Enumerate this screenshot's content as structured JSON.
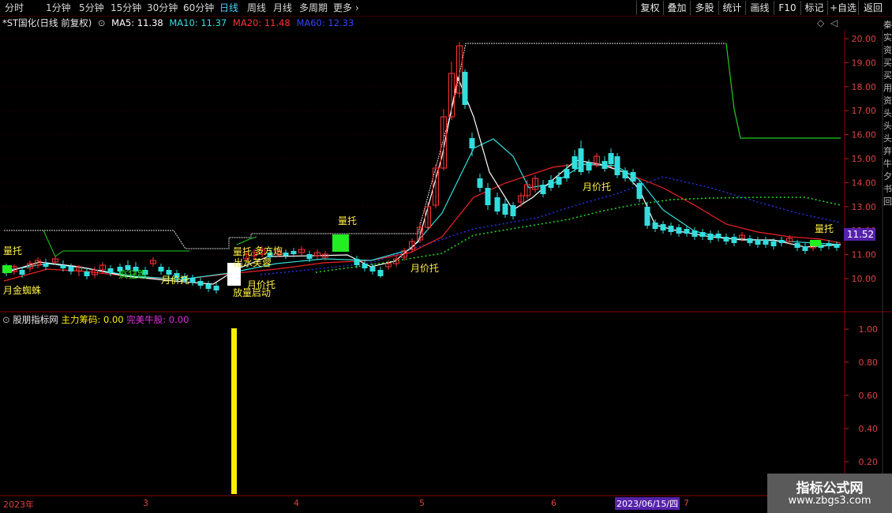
{
  "toolbar": {
    "tabs": [
      "分时",
      "1分钟",
      "5分钟",
      "15分钟",
      "30分钟",
      "60分钟",
      "日线",
      "周线",
      "月线",
      "多周期",
      "更多"
    ],
    "active_tab": "日线",
    "right_buttons": [
      "复权",
      "叠加",
      "多股",
      "统计",
      "画线",
      "F10",
      "标记",
      "+自选",
      "返回"
    ]
  },
  "info": {
    "stock": "*ST国化(日线 前复权)",
    "ma5": "MA5: 11.38",
    "ma10": "MA10: 11.37",
    "ma20": "MA20: 11.48",
    "ma60": "MA60: 12.33",
    "colors": {
      "ma5": "#ffffff",
      "ma10": "#33dddd",
      "ma20": "#ff3333",
      "ma60": "#3344ff"
    }
  },
  "price_axis": [
    "20.00",
    "19.00",
    "18.00",
    "17.00",
    "16.00",
    "15.00",
    "14.00",
    "13.00",
    "12.00",
    "11.00",
    "10.00"
  ],
  "current_price": "11.52",
  "right_side_text": [
    "秦",
    "实",
    "资",
    "买",
    "买",
    "用",
    "资",
    "头",
    "头",
    "头",
    "弃",
    "牛",
    "夕",
    "书",
    "回"
  ],
  "annotations": {
    "liang_tuo_1": "量托",
    "yue_jin_zhi_zhu": "月金蜘蛛",
    "kuai_pao": "疯狂跑",
    "yue_jia_tuo_1": "月价托",
    "liang_tuo_2": "量托",
    "duo_fang_pao": "多方炮",
    "chu_shui_fu_rong": "出水芙蓉",
    "yue_jia_tuo_2": "月价托",
    "fang_liang_qi_dong": "放量启动",
    "liang_tuo_3": "量托",
    "yue_jia_tuo_3": "月价托",
    "yue_jia_tuo_4": "月价托",
    "liang_tuo_4": "量托"
  },
  "indicator": {
    "name": "股朋指标网",
    "zhu_li": "主力筹码: 0.00",
    "niu_gu": "完美牛股: 0.00",
    "axis": [
      "1.00",
      "0.80",
      "0.60",
      "0.40",
      "0.20"
    ]
  },
  "dates": {
    "labels": [
      "2023年",
      "3",
      "4",
      "5",
      "6",
      "7"
    ],
    "cursor": "2023/06/15/四"
  },
  "watermark": {
    "title": "指标公式网",
    "url": "www.zbgs3.com"
  }
}
